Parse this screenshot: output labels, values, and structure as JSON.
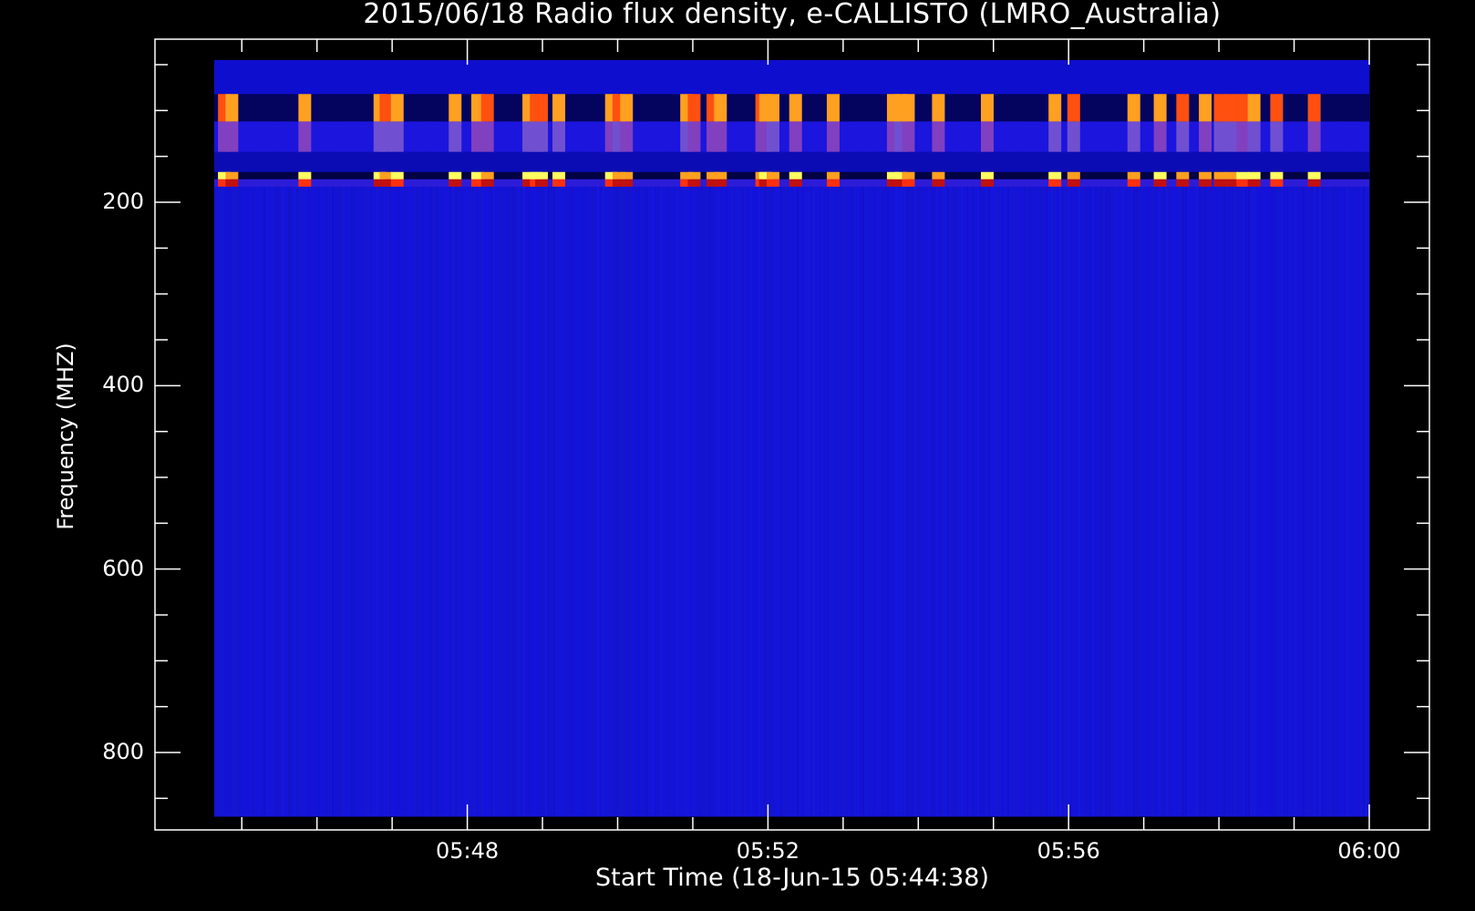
{
  "chart_data": {
    "type": "heatmap",
    "title": "2015/06/18  Radio flux density, e-CALLISTO (LMRO_Australia)",
    "xlabel": "Start Time (18-Jun-15 05:44:38)",
    "ylabel": "Frequency (MHZ)",
    "x_tick_labels": [
      "05:48",
      "05:52",
      "05:56",
      "06:00"
    ],
    "x_tick_minutes": [
      3.367,
      7.367,
      11.367,
      15.367
    ],
    "y_tick_labels": [
      "200",
      "400",
      "600",
      "800"
    ],
    "y_tick_values": [
      200,
      400,
      600,
      800
    ],
    "xlim_minutes": [
      0,
      15.367
    ],
    "ylim_mhz": [
      45,
      870
    ],
    "y_reversed": true,
    "data_range_mhz": [
      45,
      870
    ],
    "colormap": [
      "#000033",
      "#1010e0",
      "#8040c0",
      "#ff3010",
      "#ffa020",
      "#ffff60"
    ],
    "background_color": "#1414d8",
    "bands_mhz": [
      {
        "from": 45,
        "to": 82,
        "level": 0.18
      },
      {
        "from": 82,
        "to": 112,
        "level": 0.05
      },
      {
        "from": 112,
        "to": 145,
        "level": 0.22
      },
      {
        "from": 145,
        "to": 167,
        "level": 0.15
      },
      {
        "from": 167,
        "to": 175,
        "level": 0.02
      },
      {
        "from": 175,
        "to": 183,
        "level": 0.25
      }
    ],
    "burst_times_minutes": [
      0.05,
      0.15,
      1.12,
      2.12,
      2.2,
      2.35,
      3.12,
      3.42,
      3.55,
      4.1,
      4.2,
      4.27,
      4.5,
      5.2,
      5.3,
      5.4,
      6.2,
      6.3,
      6.55,
      6.65,
      7.2,
      7.25,
      7.35,
      7.65,
      8.15,
      8.95,
      9.05,
      9.15,
      9.55,
      10.2,
      11.1,
      11.35,
      12.15,
      12.5,
      12.8,
      13.1,
      13.3,
      13.45,
      13.6,
      13.75,
      14.05,
      14.55
    ]
  }
}
